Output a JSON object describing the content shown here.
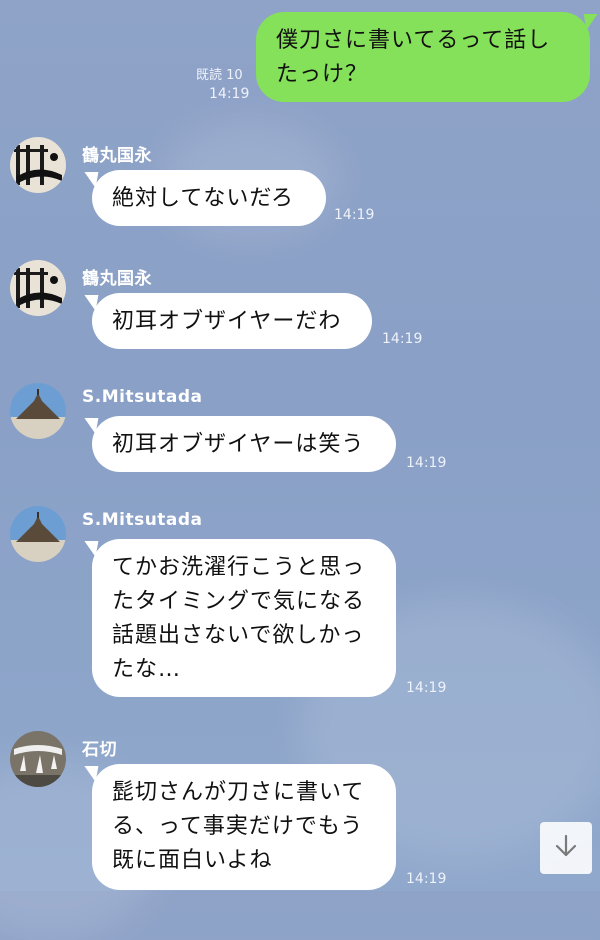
{
  "messages": [
    {
      "id": "m1",
      "side": "out",
      "text": "僕刀さに書いてるって話したっけ？",
      "read": "既読 10",
      "time": "14:19"
    },
    {
      "id": "m2",
      "side": "in",
      "sender": "鶴丸国永",
      "avatar": "tsurumaru-avatar",
      "text": "絶対してないだろ",
      "time": "14:19"
    },
    {
      "id": "m3",
      "side": "in",
      "sender": "鶴丸国永",
      "avatar": "tsurumaru-avatar",
      "text": "初耳オブザイヤーだわ",
      "time": "14:19"
    },
    {
      "id": "m4",
      "side": "in",
      "sender": "S.Mitsutada",
      "avatar": "mitsutada-avatar",
      "text": "初耳オブザイヤーは笑う",
      "time": "14:19"
    },
    {
      "id": "m5",
      "side": "in",
      "sender": "S.Mitsutada",
      "avatar": "mitsutada-avatar",
      "text": "てかお洗濯行こうと思ったタイミングで気になる話題出さないで欲しかったな…",
      "time": "14:19"
    },
    {
      "id": "m6",
      "side": "in",
      "sender": "石切",
      "avatar": "ishikiri-avatar",
      "text": "髭切さんが刀さに書いてる、って事実だけでもう既に面白いよね",
      "time": "14:19"
    }
  ],
  "scroll_button": {
    "icon": "arrow-down-icon"
  },
  "colors": {
    "outgoing_bubble": "#85e05a",
    "incoming_bubble": "#ffffff",
    "background": "#8ea4c8"
  }
}
